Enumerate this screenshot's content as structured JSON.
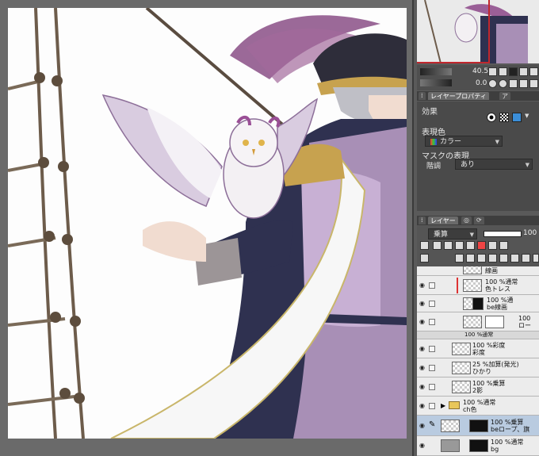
{
  "navigator": {
    "zoom_value": "40.5",
    "rotate_value": "0.0"
  },
  "layer_property_tabs": {
    "tab1": "レイヤープロパティ",
    "tab2": "ア"
  },
  "layer_property": {
    "effect_label": "効果",
    "expression_color_label": "表現色",
    "expression_color_value": "カラー",
    "mask_label": "マスクの表現",
    "gradation_label": "階調",
    "gradation_value": "あり"
  },
  "layer_panel_tabs": {
    "tab1": "レイヤー"
  },
  "layer_panel": {
    "blend_mode": "乗算",
    "opacity": "100"
  },
  "layers": [
    {
      "line1": "線画",
      "line2": "",
      "selected": false
    },
    {
      "line1": "100 %通常",
      "line2": "色トレス",
      "selected": false
    },
    {
      "line1": "100 %通",
      "line2": "be線画",
      "selected": false
    },
    {
      "line1": "100",
      "line2": "ロー",
      "selected": false
    },
    {
      "line1": "100 %通常",
      "line2": "",
      "selected": false
    },
    {
      "line1": "100 %彩度",
      "line2": "彩度",
      "selected": false
    },
    {
      "line1": "25 %加算(発光)",
      "line2": "ひかり",
      "selected": false
    },
    {
      "line1": "100 %乗算",
      "line2": "2影",
      "selected": false
    },
    {
      "line1": "100 %通常",
      "line2": "ch色",
      "selected": false
    },
    {
      "line1": "100 %乗算",
      "line2": "beロープ、旗",
      "selected": true
    },
    {
      "line1": "100 %通常",
      "line2": "bg",
      "selected": false
    }
  ],
  "colors": {
    "accent_red": "#c1272d",
    "panel_dark": "#4a4a4a",
    "layer_bg": "#ececec",
    "selected_row": "#b9cbe0"
  }
}
